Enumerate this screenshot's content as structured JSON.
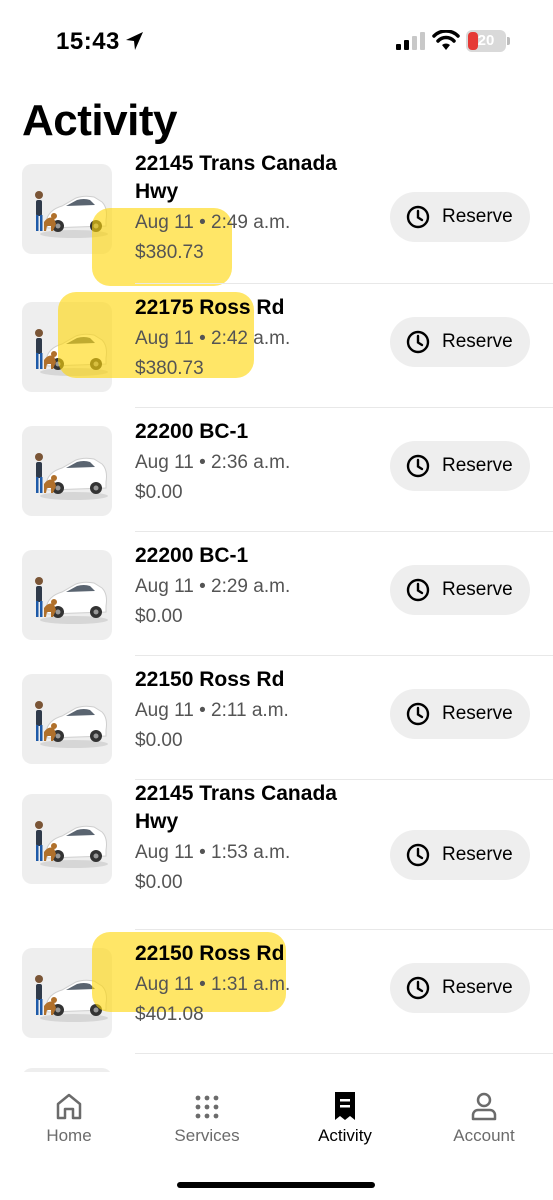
{
  "status_bar": {
    "time": "15:43",
    "battery": "20",
    "battery_color": "#e53935"
  },
  "page": {
    "title": "Activity"
  },
  "trips": [
    {
      "address": "22145 Trans Canada Hwy",
      "datetime": "Aug 11 • 2:49 a.m.",
      "price": "$380.73",
      "highlighted": true
    },
    {
      "address": "22175 Ross Rd",
      "datetime": "Aug 11 • 2:42 a.m.",
      "price": "$380.73",
      "highlighted": true
    },
    {
      "address": "22200 BC-1",
      "datetime": "Aug 11 • 2:36 a.m.",
      "price": "$0.00",
      "highlighted": false
    },
    {
      "address": "22200 BC-1",
      "datetime": "Aug 11 • 2:29 a.m.",
      "price": "$0.00",
      "highlighted": false
    },
    {
      "address": "22150 Ross Rd",
      "datetime": "Aug 11 • 2:11 a.m.",
      "price": "$0.00",
      "highlighted": false
    },
    {
      "address": "22145 Trans Canada Hwy",
      "datetime": "Aug 11 • 1:53 a.m.",
      "price": "$0.00",
      "highlighted": false
    },
    {
      "address": "22150 Ross Rd",
      "datetime": "Aug 11 • 1:31 a.m.",
      "price": "$401.08",
      "highlighted": true
    }
  ],
  "reserve_label": "Reserve",
  "tabs": [
    {
      "label": "Home",
      "icon": "home-icon",
      "active": false
    },
    {
      "label": "Services",
      "icon": "grid-icon",
      "active": false
    },
    {
      "label": "Activity",
      "icon": "receipt-icon",
      "active": true
    },
    {
      "label": "Account",
      "icon": "person-icon",
      "active": false
    }
  ],
  "colors": {
    "highlight": "#ffd60a",
    "button_bg": "#eeeeee",
    "secondary_text": "#545454"
  }
}
